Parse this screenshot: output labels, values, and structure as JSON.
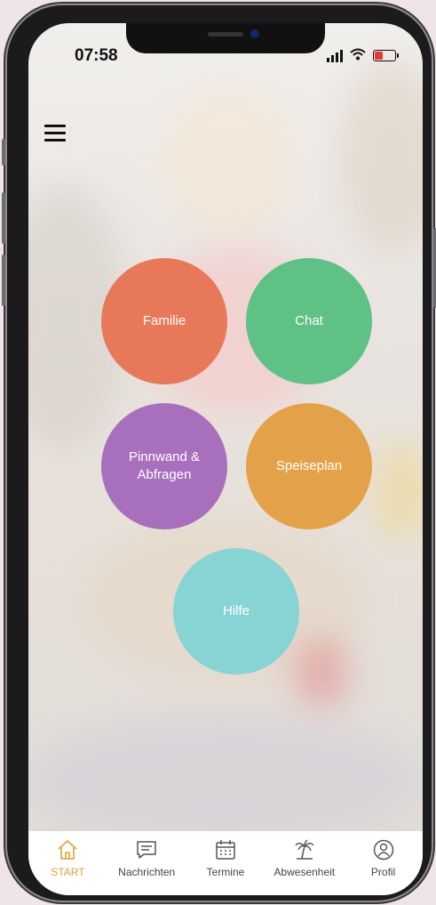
{
  "status": {
    "time": "07:58"
  },
  "menu": {
    "icon": "hamburger-menu-icon"
  },
  "tiles": [
    {
      "label": "Familie",
      "color": "#e8785a"
    },
    {
      "label": "Chat",
      "color": "#5fc185"
    },
    {
      "label": "Pinnwand &\nAbfragen",
      "color": "#a86fbd"
    },
    {
      "label": "Speiseplan",
      "color": "#e3a24a"
    },
    {
      "label": "Hilfe",
      "color": "#88d3d3"
    }
  ],
  "tabbar": {
    "accent": "#e2a036",
    "items": [
      {
        "label": "START",
        "icon": "home-icon",
        "active": true
      },
      {
        "label": "Nachrichten",
        "icon": "message-icon",
        "active": false
      },
      {
        "label": "Termine",
        "icon": "calendar-icon",
        "active": false
      },
      {
        "label": "Abwesenheit",
        "icon": "palm-tree-icon",
        "active": false
      },
      {
        "label": "Profil",
        "icon": "profile-icon",
        "active": false
      }
    ]
  }
}
